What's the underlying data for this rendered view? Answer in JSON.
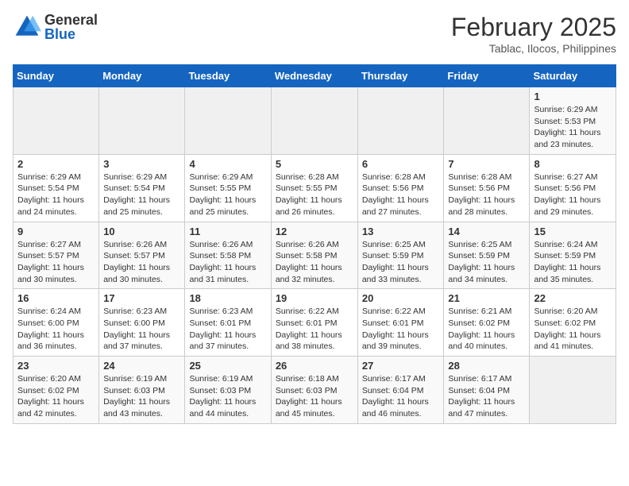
{
  "header": {
    "logo_general": "General",
    "logo_blue": "Blue",
    "month_year": "February 2025",
    "location": "Tablac, Ilocos, Philippines"
  },
  "days_of_week": [
    "Sunday",
    "Monday",
    "Tuesday",
    "Wednesday",
    "Thursday",
    "Friday",
    "Saturday"
  ],
  "weeks": [
    [
      {
        "day": "",
        "info": ""
      },
      {
        "day": "",
        "info": ""
      },
      {
        "day": "",
        "info": ""
      },
      {
        "day": "",
        "info": ""
      },
      {
        "day": "",
        "info": ""
      },
      {
        "day": "",
        "info": ""
      },
      {
        "day": "1",
        "info": "Sunrise: 6:29 AM\nSunset: 5:53 PM\nDaylight: 11 hours and 23 minutes."
      }
    ],
    [
      {
        "day": "2",
        "info": "Sunrise: 6:29 AM\nSunset: 5:54 PM\nDaylight: 11 hours and 24 minutes."
      },
      {
        "day": "3",
        "info": "Sunrise: 6:29 AM\nSunset: 5:54 PM\nDaylight: 11 hours and 25 minutes."
      },
      {
        "day": "4",
        "info": "Sunrise: 6:29 AM\nSunset: 5:55 PM\nDaylight: 11 hours and 25 minutes."
      },
      {
        "day": "5",
        "info": "Sunrise: 6:28 AM\nSunset: 5:55 PM\nDaylight: 11 hours and 26 minutes."
      },
      {
        "day": "6",
        "info": "Sunrise: 6:28 AM\nSunset: 5:56 PM\nDaylight: 11 hours and 27 minutes."
      },
      {
        "day": "7",
        "info": "Sunrise: 6:28 AM\nSunset: 5:56 PM\nDaylight: 11 hours and 28 minutes."
      },
      {
        "day": "8",
        "info": "Sunrise: 6:27 AM\nSunset: 5:56 PM\nDaylight: 11 hours and 29 minutes."
      }
    ],
    [
      {
        "day": "9",
        "info": "Sunrise: 6:27 AM\nSunset: 5:57 PM\nDaylight: 11 hours and 30 minutes."
      },
      {
        "day": "10",
        "info": "Sunrise: 6:26 AM\nSunset: 5:57 PM\nDaylight: 11 hours and 30 minutes."
      },
      {
        "day": "11",
        "info": "Sunrise: 6:26 AM\nSunset: 5:58 PM\nDaylight: 11 hours and 31 minutes."
      },
      {
        "day": "12",
        "info": "Sunrise: 6:26 AM\nSunset: 5:58 PM\nDaylight: 11 hours and 32 minutes."
      },
      {
        "day": "13",
        "info": "Sunrise: 6:25 AM\nSunset: 5:59 PM\nDaylight: 11 hours and 33 minutes."
      },
      {
        "day": "14",
        "info": "Sunrise: 6:25 AM\nSunset: 5:59 PM\nDaylight: 11 hours and 34 minutes."
      },
      {
        "day": "15",
        "info": "Sunrise: 6:24 AM\nSunset: 5:59 PM\nDaylight: 11 hours and 35 minutes."
      }
    ],
    [
      {
        "day": "16",
        "info": "Sunrise: 6:24 AM\nSunset: 6:00 PM\nDaylight: 11 hours and 36 minutes."
      },
      {
        "day": "17",
        "info": "Sunrise: 6:23 AM\nSunset: 6:00 PM\nDaylight: 11 hours and 37 minutes."
      },
      {
        "day": "18",
        "info": "Sunrise: 6:23 AM\nSunset: 6:01 PM\nDaylight: 11 hours and 37 minutes."
      },
      {
        "day": "19",
        "info": "Sunrise: 6:22 AM\nSunset: 6:01 PM\nDaylight: 11 hours and 38 minutes."
      },
      {
        "day": "20",
        "info": "Sunrise: 6:22 AM\nSunset: 6:01 PM\nDaylight: 11 hours and 39 minutes."
      },
      {
        "day": "21",
        "info": "Sunrise: 6:21 AM\nSunset: 6:02 PM\nDaylight: 11 hours and 40 minutes."
      },
      {
        "day": "22",
        "info": "Sunrise: 6:20 AM\nSunset: 6:02 PM\nDaylight: 11 hours and 41 minutes."
      }
    ],
    [
      {
        "day": "23",
        "info": "Sunrise: 6:20 AM\nSunset: 6:02 PM\nDaylight: 11 hours and 42 minutes."
      },
      {
        "day": "24",
        "info": "Sunrise: 6:19 AM\nSunset: 6:03 PM\nDaylight: 11 hours and 43 minutes."
      },
      {
        "day": "25",
        "info": "Sunrise: 6:19 AM\nSunset: 6:03 PM\nDaylight: 11 hours and 44 minutes."
      },
      {
        "day": "26",
        "info": "Sunrise: 6:18 AM\nSunset: 6:03 PM\nDaylight: 11 hours and 45 minutes."
      },
      {
        "day": "27",
        "info": "Sunrise: 6:17 AM\nSunset: 6:04 PM\nDaylight: 11 hours and 46 minutes."
      },
      {
        "day": "28",
        "info": "Sunrise: 6:17 AM\nSunset: 6:04 PM\nDaylight: 11 hours and 47 minutes."
      },
      {
        "day": "",
        "info": ""
      }
    ]
  ]
}
